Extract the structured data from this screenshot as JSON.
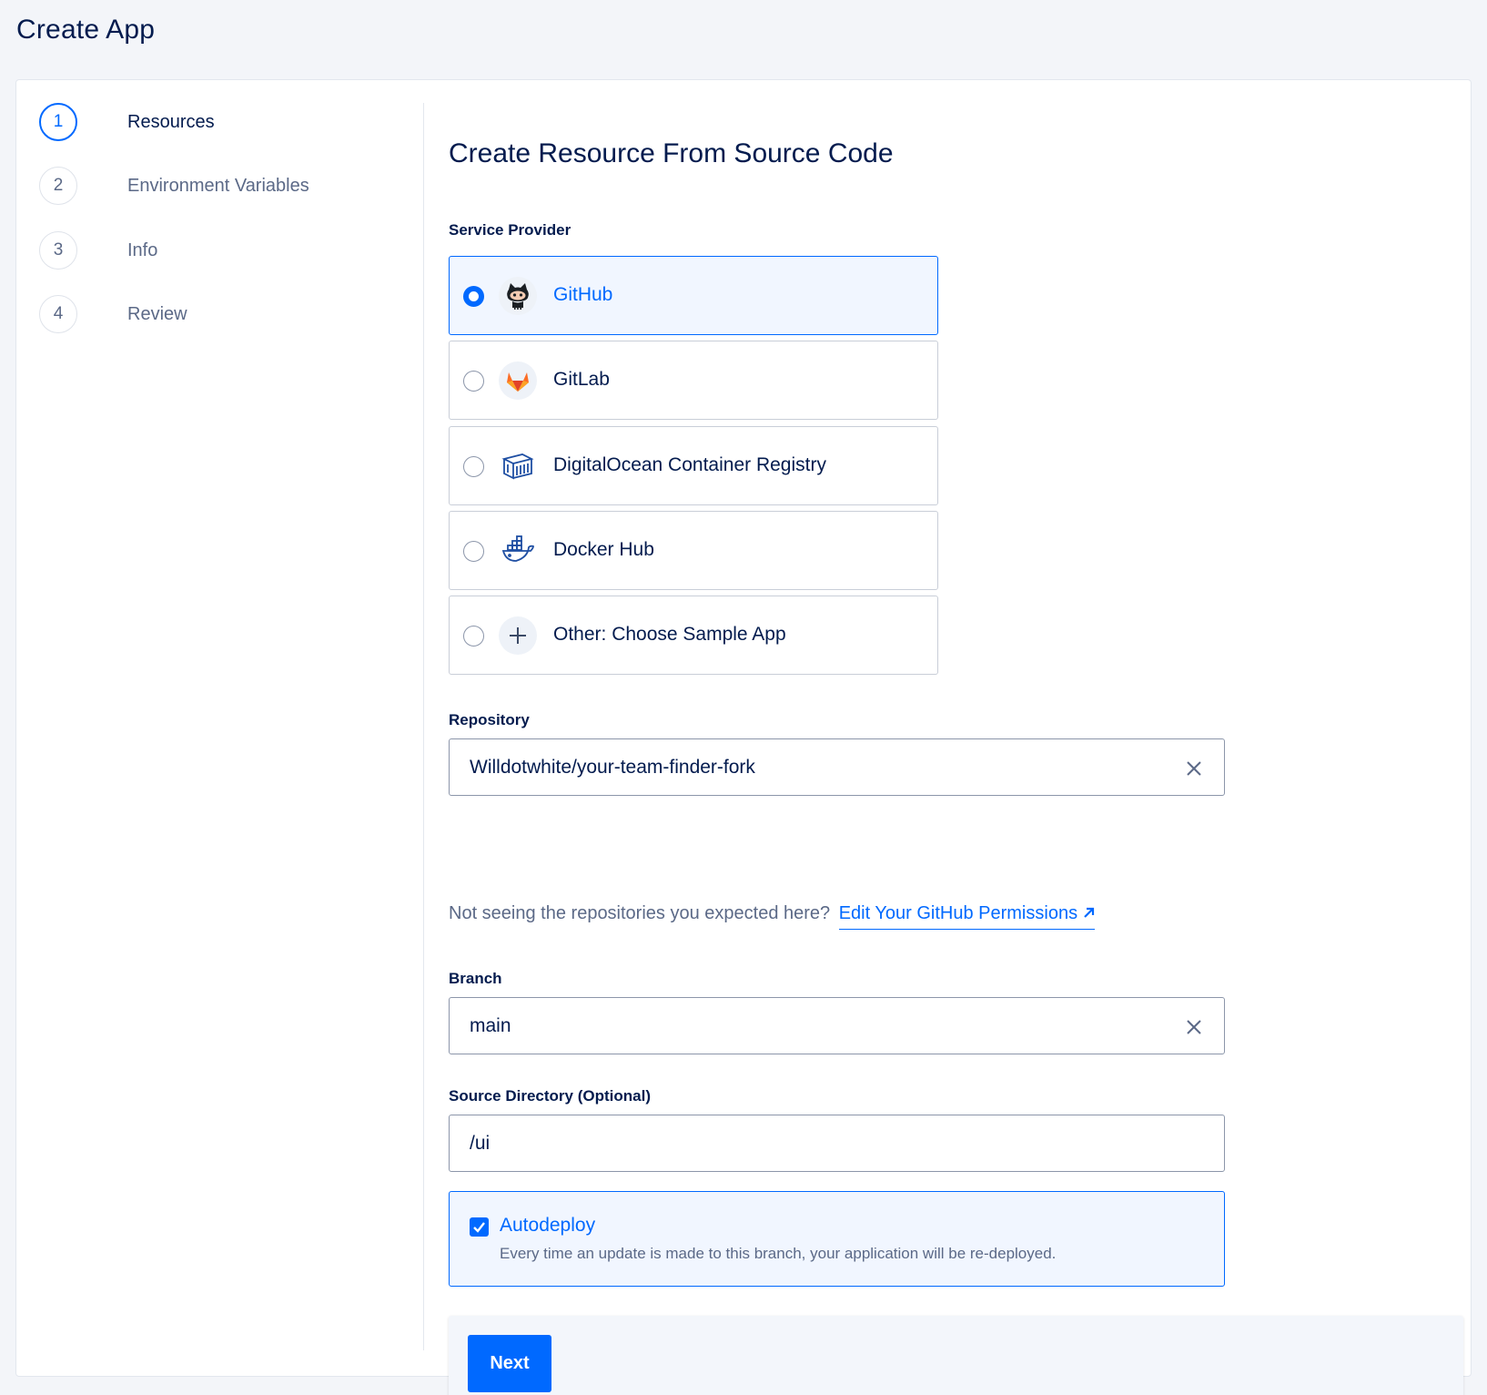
{
  "page": {
    "title": "Create App"
  },
  "steps": [
    {
      "number": "1",
      "label": "Resources",
      "active": true
    },
    {
      "number": "2",
      "label": "Environment Variables",
      "active": false
    },
    {
      "number": "3",
      "label": "Info",
      "active": false
    },
    {
      "number": "4",
      "label": "Review",
      "active": false
    }
  ],
  "main": {
    "title": "Create Resource From Source Code",
    "service_provider_label": "Service Provider",
    "providers": [
      {
        "label": "GitHub",
        "icon": "github-icon",
        "selected": true
      },
      {
        "label": "GitLab",
        "icon": "gitlab-icon",
        "selected": false
      },
      {
        "label": "DigitalOcean Container Registry",
        "icon": "container-registry-icon",
        "selected": false
      },
      {
        "label": "Docker Hub",
        "icon": "docker-icon",
        "selected": false
      },
      {
        "label": "Other: Choose Sample App",
        "icon": "plus-icon",
        "selected": false
      }
    ],
    "repository": {
      "label": "Repository",
      "value": "Willdotwhite/your-team-finder-fork"
    },
    "helper": {
      "text": "Not seeing the repositories you expected here?",
      "link": "Edit Your GitHub Permissions"
    },
    "branch": {
      "label": "Branch",
      "value": "main"
    },
    "source_dir": {
      "label": "Source Directory (Optional)",
      "value": "/ui"
    },
    "autodeploy": {
      "checked": true,
      "label": "Autodeploy",
      "description": "Every time an update is made to this branch, your application will be re-deployed."
    },
    "next_label": "Next"
  },
  "colors": {
    "accent": "#0069ff",
    "text": "#031b4e",
    "muted": "#5b6987",
    "border": "#c9ced8"
  }
}
